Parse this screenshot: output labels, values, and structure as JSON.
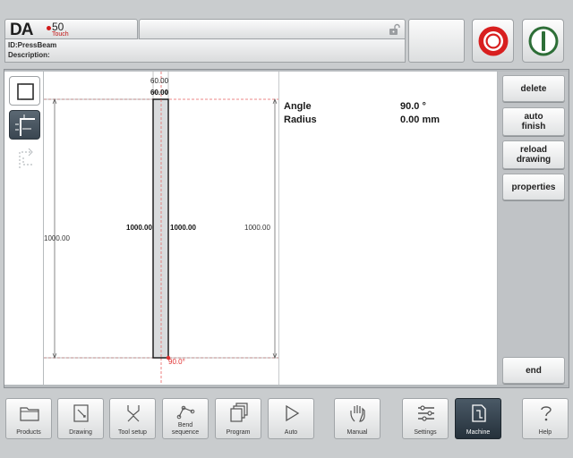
{
  "header": {
    "logo_da": "DA",
    "logo_num": "50",
    "logo_sub": "Touch",
    "id_line": "ID:PressBeam",
    "description_line": "Description:"
  },
  "colors": {
    "stop_red": "#d81f1f",
    "start_green": "#2d6e37",
    "active_nav": "#2f3c47",
    "dimension_red": "#e03030"
  },
  "tools": [
    "select-rect-icon",
    "bend-line-icon",
    "dashed-bend-icon"
  ],
  "drawing": {
    "width_top_1": "60.00",
    "width_top_2": "60.00",
    "left_dim": "1000.00",
    "inner_left_dim": "1000.00",
    "inner_right_dim": "1000.00",
    "right_dim": "1000.00",
    "bend_angle": "90.0°"
  },
  "properties": {
    "angle_label": "Angle",
    "angle_value": "90.0 °",
    "radius_label": "Radius",
    "radius_value": "0.00 mm"
  },
  "side_buttons": {
    "delete": "delete",
    "auto_finish_1": "auto",
    "auto_finish_2": "finish",
    "reload_1": "reload",
    "reload_2": "drawing",
    "properties": "properties",
    "end": "end"
  },
  "nav": {
    "products": "Products",
    "drawing": "Drawing",
    "tool_setup": "Tool setup",
    "bend_sequence_1": "Bend",
    "bend_sequence_2": "sequence",
    "program": "Program",
    "auto": "Auto",
    "manual": "Manual",
    "settings": "Settings",
    "machine": "Machine",
    "help": "Help"
  }
}
